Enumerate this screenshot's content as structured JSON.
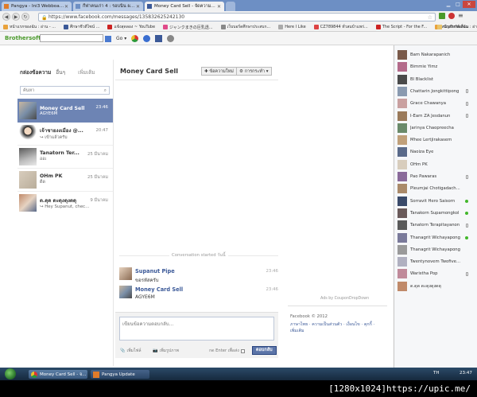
{
  "browser": {
    "tabs": [
      {
        "label": "Pangya - Ini3 Webboard - ..."
      },
      {
        "label": "กีฬาคนเก่า 4 : รอบนิน ผลกรุ่นต..."
      },
      {
        "label": "Money Card Sell - จัดความ..."
      }
    ],
    "url": "https://www.facebook.com/messages/135832625242130",
    "bookmarks": [
      "หน้าแรกของฉัน : อ่าน - ...",
      "ศึกษาชีวดีไซน์ ...",
      "แข้งสุดลอง ~ YouTube",
      "ジャンクまきの巨乳透...",
      "เว็บบอร์ดศึกษาประสบก...",
      "Here I Like",
      "CZ789844 ทั่วสมบ้าแพร่...",
      "The Script - For the F...",
      "หน้าแรกของฉัน : อ่าน - ...",
      "บัญชีหรัส์เสื่อม"
    ]
  },
  "extbar": {
    "logo": "Brothersoft"
  },
  "messages": {
    "header_label": "กล่องข้อความ",
    "header_other": "อื่นๆ",
    "header_new": "เพิ่มเติม",
    "search_placeholder": "ค้นหา",
    "conversations": [
      {
        "name": "Money Card Sell",
        "snippet": "AGYE6M",
        "time": "23:46"
      },
      {
        "name": "เจ้าชายงงเมือง @...",
        "snippet": "↪ เข้าแล้วครับ",
        "time": "20:47"
      },
      {
        "name": "Tanatorn Ter...",
        "snippet": "ออเ",
        "time": "25 มีนาคม"
      },
      {
        "name": "OHm PK",
        "snippet": "ดีด",
        "time": "25 มีนาคม"
      },
      {
        "name": "ด.ดุด ดะดุงดุงดดุ",
        "snippet": "↪ Hey Supanut, check ...",
        "time": "9 มีนาคม"
      }
    ]
  },
  "thread": {
    "title": "Money Card Sell",
    "new_message_button": "ข้อความใหม่",
    "actions_button": "การกระทำ",
    "started_label": "Conversation started วันนี้",
    "entries": [
      {
        "sender": "Supanut Pipe",
        "text": "ขอรหัสครับ",
        "time": "23:46"
      },
      {
        "sender": "Money Card Sell",
        "text": "AGYE6M",
        "time": "23:46"
      }
    ],
    "ads_by": "Ads by CouponDropDown",
    "reply_placeholder": "เขียนข้อความตอบกลับ...",
    "attach_file": "เพิ่มไฟล์",
    "attach_photo": "เพิ่มรูปภาพ",
    "enter_label": "กด Enter เพื่อส่ง",
    "reply_button": "ตอบกลับ"
  },
  "footer": {
    "copyright": "Facebook © 2012",
    "links": "ภาษาไทย · ความเป็นส่วนตัว · เงื่อนไข · คุกกี้ · เพิ่มเติม"
  },
  "chat_friends": [
    {
      "name": "Bam Nakarapanich",
      "status": "none"
    },
    {
      "name": "Bimmie Yimz",
      "status": "none"
    },
    {
      "name": "Bl Blacklist",
      "status": "none"
    },
    {
      "name": "Chattarin Jongkittipong",
      "status": "mobile"
    },
    {
      "name": "Grace Chawanya",
      "status": "mobile"
    },
    {
      "name": "I-Earn ZA Jesdanun",
      "status": "mobile"
    },
    {
      "name": "Jarinya Chaopreecha",
      "status": "none"
    },
    {
      "name": "Mhee Lertjirakasem",
      "status": "none"
    },
    {
      "name": "Naoiza Eye",
      "status": "none"
    },
    {
      "name": "OHm PK",
      "status": "none"
    },
    {
      "name": "Pao Pawaras",
      "status": "mobile"
    },
    {
      "name": "Pleumjai Chotigadach...",
      "status": "none"
    },
    {
      "name": "Sorravit Hero Saisorn",
      "status": "online"
    },
    {
      "name": "Tanakorn Supamongkol",
      "status": "online"
    },
    {
      "name": "Tanatorn Terapitayanon",
      "status": "mobile"
    },
    {
      "name": "Thanagrit Wichayapong",
      "status": "online"
    },
    {
      "name": "Thanagrit Wichayapong",
      "status": "none"
    },
    {
      "name": "Twentynovem Twofive...",
      "status": "none"
    },
    {
      "name": "Waristha Pop",
      "status": "mobile"
    },
    {
      "name": "ด.ดุด ดะดุงดุงดดุ",
      "status": "none"
    }
  ],
  "taskbar": {
    "tasks": [
      "Money Card Sell - จ...",
      "Pangya Update"
    ],
    "lang": "TH",
    "clock": "23:47"
  },
  "caption": "[1280x1024]https://upic.me/"
}
